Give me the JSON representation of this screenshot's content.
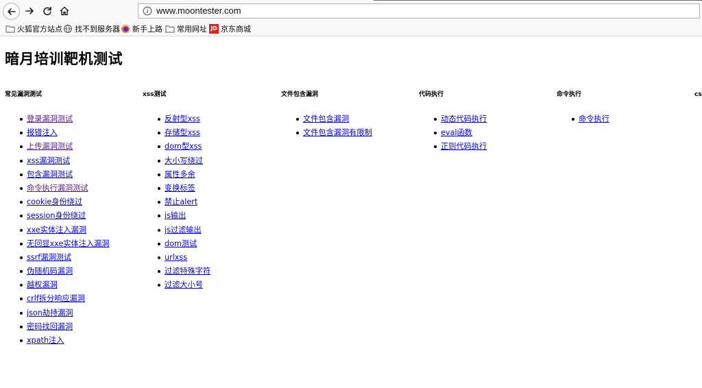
{
  "browser": {
    "url": "www.moontester.com",
    "bookmarks": [
      {
        "label": "火狐官方站点",
        "icon": "folder-icon"
      },
      {
        "label": "找不到服务器",
        "icon": "globe-icon"
      },
      {
        "label": "新手上路",
        "icon": "firefox-icon"
      },
      {
        "label": "常用网址",
        "icon": "folder-icon"
      },
      {
        "label": "京东商城",
        "icon": "jd-icon",
        "icon_text": "JD"
      }
    ]
  },
  "page": {
    "title": "暗月培训靶机测试",
    "columns": [
      {
        "heading": "常见漏洞测试",
        "links": [
          "登录漏洞测试",
          "报错注入",
          "上传漏洞测试",
          "xss漏洞测试",
          "包含漏洞测试",
          "命令执行漏洞测试",
          "cookie身份绕过",
          "session身份绕过",
          "xxe实体注入漏洞",
          "无回显xxe实体注入漏洞",
          "ssrf漏洞测试",
          "伪随机码漏洞",
          "越权漏洞",
          "crlf拆分响应漏洞",
          "json劫持漏洞",
          "密码找回漏洞",
          "xpath注入"
        ]
      },
      {
        "heading": "xss测试",
        "links": [
          "反射型xss",
          "存储型xss",
          "dom型xss",
          "大小写绕过",
          "属性多余",
          "变换标签",
          "禁止alert",
          "js输出",
          "js过滤输出",
          "dom测试",
          "urlxss",
          "过滤特殊字符",
          "过滤大小号"
        ]
      },
      {
        "heading": "文件包含漏洞",
        "links": [
          "文件包含漏洞",
          "文件包含漏洞有限制"
        ]
      },
      {
        "heading": "代码执行",
        "links": [
          "动态代码执行",
          "eval函数",
          "正则代码执行"
        ]
      },
      {
        "heading": "命令执行",
        "links": [
          "命令执行"
        ]
      },
      {
        "heading": "cs",
        "links": []
      }
    ]
  },
  "colors": {
    "link": "#0000ee",
    "visited": "#551a8b"
  }
}
